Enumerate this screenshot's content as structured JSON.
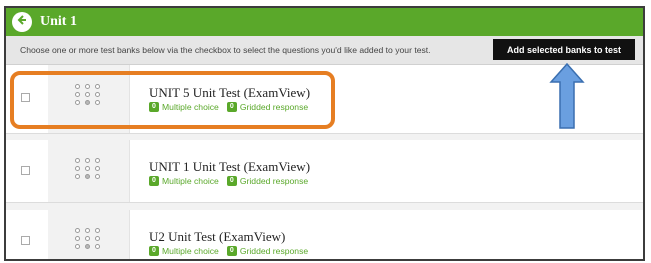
{
  "header": {
    "title": "Unit 1"
  },
  "instruction": "Choose one or more test banks below via the checkbox to select the questions you'd like added to your test.",
  "add_button_label": "Add selected banks to test",
  "banks": [
    {
      "title": "UNIT 5 Unit Test (ExamView)",
      "mc_count": "0",
      "mc_label": "Multiple choice",
      "gr_count": "0",
      "gr_label": "Gridded response"
    },
    {
      "title": "UNIT 1 Unit Test (ExamView)",
      "mc_count": "0",
      "mc_label": "Multiple choice",
      "gr_count": "0",
      "gr_label": "Gridded response"
    },
    {
      "title": "U2 Unit Test (ExamView)",
      "mc_count": "0",
      "mc_label": "Multiple choice",
      "gr_count": "0",
      "gr_label": "Gridded response"
    }
  ],
  "colors": {
    "accent": "#5aa82a",
    "highlight": "#e67e22",
    "arrow": "#6a9fe0"
  }
}
